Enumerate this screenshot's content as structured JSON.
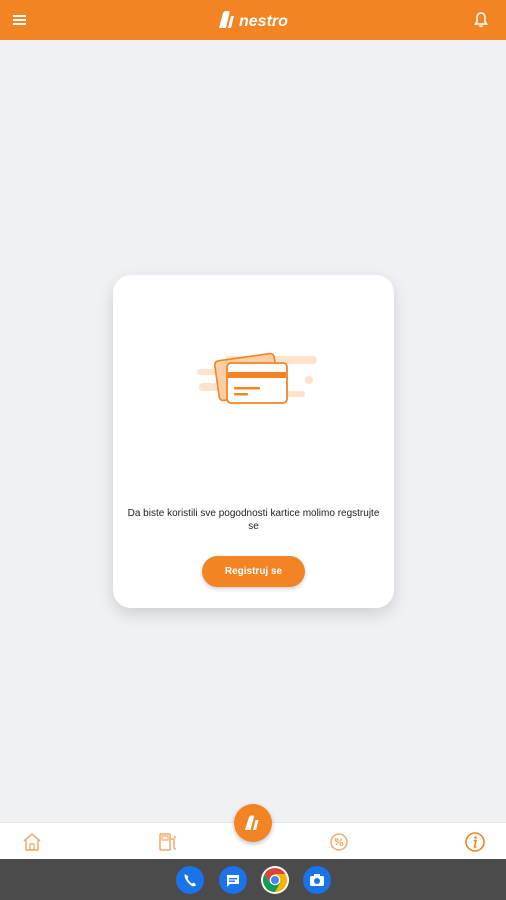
{
  "header": {
    "brand_text": "nestro",
    "menu_icon": "hamburger-menu-icon",
    "notification_icon": "bell-icon"
  },
  "card": {
    "message": "Da biste koristili sve pogodnosti kartice molimo regstrujte se",
    "register_button": "Registruj se",
    "illustration_icon": "cards-illustration"
  },
  "bottom_nav": {
    "items": [
      {
        "icon": "home-icon"
      },
      {
        "icon": "fuel-pump-icon"
      },
      {
        "icon": "nestro-logo-icon"
      },
      {
        "icon": "coupon-icon"
      },
      {
        "icon": "info-icon"
      }
    ]
  },
  "system_dock": {
    "apps": [
      "phone-icon",
      "messages-icon",
      "chrome-icon",
      "camera-icon"
    ]
  },
  "colors": {
    "accent": "#f38423",
    "background": "#eff1f5",
    "card": "#ffffff",
    "system_bar": "#4b4b4b"
  }
}
